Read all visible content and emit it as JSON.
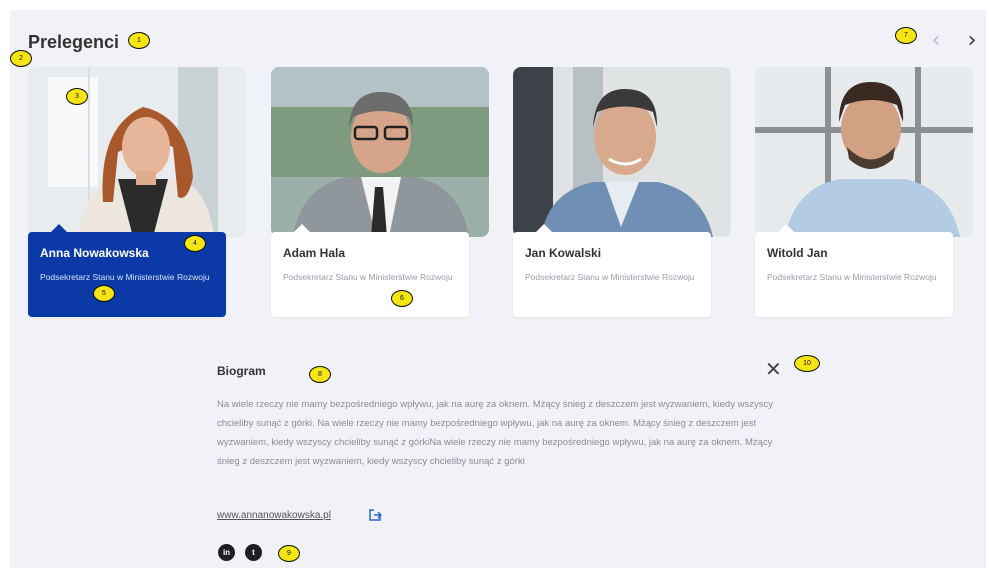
{
  "section": {
    "title": "Prelegenci"
  },
  "speakers": [
    {
      "name": "Anna Nowakowska",
      "role": "Podsekretarz Stanu w Ministerstwie Rozwoju",
      "active": true
    },
    {
      "name": "Adam Hala",
      "role": "Podsekretarz Stanu w Ministerstwie Rozwoju",
      "active": false
    },
    {
      "name": "Jan Kowalski",
      "role": "Podsekretarz Stanu w Ministerstwie Rozwoju",
      "active": false
    },
    {
      "name": "Witold Jan",
      "role": "Podsekretarz Stanu w Ministerstwie Rozwoju",
      "active": false
    }
  ],
  "bio": {
    "title": "Biogram",
    "close": "✕",
    "text": "Na wiele rzeczy nie mamy bezpośredniego wpływu, jak na aurę za oknem. Mżący śnieg z deszczem jest wyzwaniem, kiedy wszyscy chcieliby sunąć z górki. Na wiele rzeczy nie mamy bezpośredniego wpływu, jak na aurę za oknem. Mżący śnieg z deszczem jest wyzwaniem, kiedy wszyscy chcieliby sunąć z górkiNa wiele rzeczy nie mamy bezpośredniego wpływu, jak na aurę za oknem. Mżący śnieg z deszczem jest wyzwaniem, kiedy wszyscy chcieliby sunąć z górki",
    "link": "www.annanowakowska.pl"
  },
  "social": {
    "linkedin": "in",
    "twitter": "t"
  },
  "nav": {
    "prev": "‹",
    "next": "›"
  },
  "annotations": [
    "1",
    "2",
    "3",
    "4",
    "5",
    "6",
    "7",
    "8",
    "9",
    "10"
  ],
  "colors": {
    "accent": "#0b3aa6",
    "panel": "#f1f2f7",
    "marker": "#f5e613"
  },
  "icons": {
    "external": "external-link-icon",
    "linkedin": "linkedin-icon",
    "twitter": "twitter-icon"
  }
}
